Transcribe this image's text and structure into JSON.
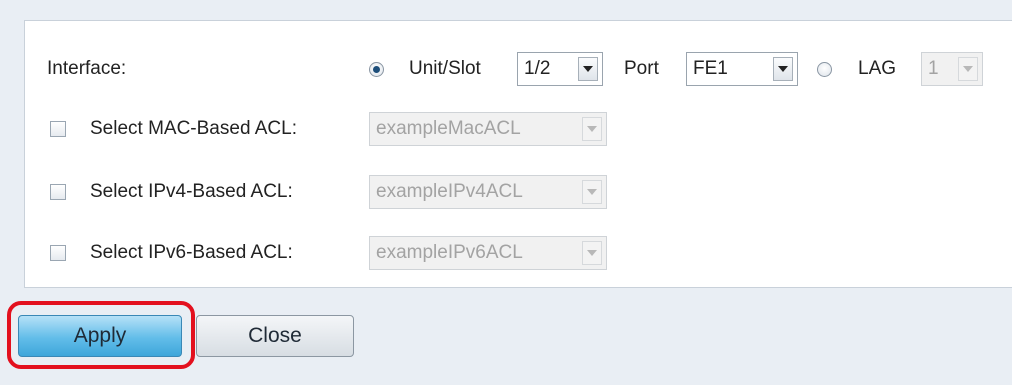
{
  "interface": {
    "label": "Interface:",
    "unit_slot": {
      "label": "Unit/Slot",
      "selected": true,
      "value": "1/2"
    },
    "port": {
      "label": "Port",
      "value": "FE1"
    },
    "lag": {
      "label": "LAG",
      "selected": false,
      "value": "1"
    }
  },
  "acls": [
    {
      "label": "Select MAC-Based ACL:",
      "value": "exampleMacACL",
      "checked": false
    },
    {
      "label": "Select IPv4-Based ACL:",
      "value": "exampleIPv4ACL",
      "checked": false
    },
    {
      "label": "Select IPv6-Based ACL:",
      "value": "exampleIPv6ACL",
      "checked": false
    }
  ],
  "buttons": {
    "apply": "Apply",
    "close": "Close"
  },
  "colors": {
    "highlight": "#e3101e",
    "apply_bg": "#62bde9"
  }
}
